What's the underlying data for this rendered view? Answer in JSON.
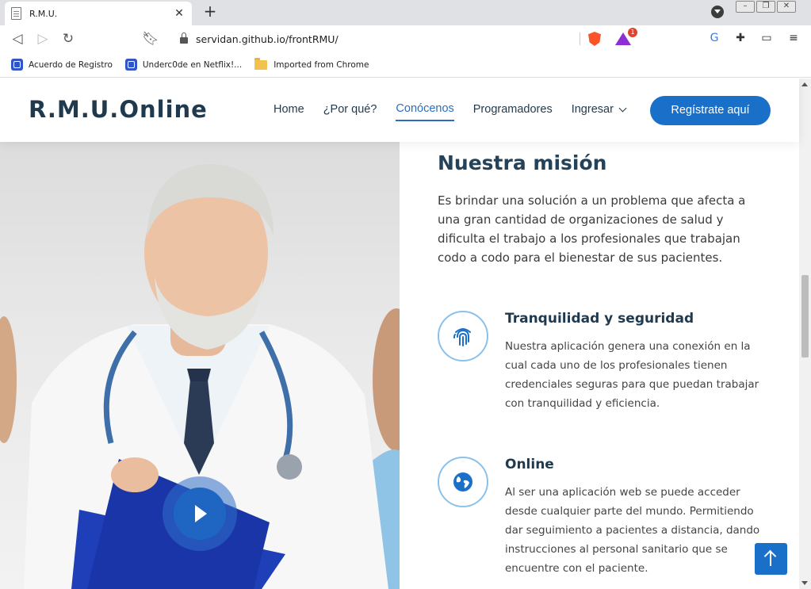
{
  "browser": {
    "tab": {
      "title": "R.M.U.",
      "favicon_icon": "document-icon",
      "close_icon": "close-icon"
    },
    "new_tab_icon": "plus-icon",
    "url": "servidan.github.io/frontRMU/",
    "bat_badge": "1",
    "bookmarks": [
      {
        "label": "Acuerdo de Registro",
        "icon": "site-favicon-icon"
      },
      {
        "label": "Underc0de en Netflix!...",
        "icon": "site-favicon-icon"
      },
      {
        "label": "Imported from Chrome",
        "icon": "folder-icon"
      }
    ]
  },
  "site": {
    "logo": "R.M.U.Online",
    "nav": {
      "home": "Home",
      "por_que": "¿Por qué?",
      "conocenos": "Conócenos",
      "programadores": "Programadores",
      "ingresar": "Ingresar"
    },
    "cta": "Regístrate aquí",
    "active_nav": "Conócenos",
    "accent_color": "#1a6fc9"
  },
  "mission": {
    "title": "Nuestra misión",
    "text": "Es brindar una solución a un problema que afecta a una gran cantidad de organizaciones de salud y dificulta el trabajo a los profesionales que trabajan codo a codo para el bienestar de sus pacientes."
  },
  "features": [
    {
      "icon": "fingerprint-icon",
      "title": "Tranquilidad y seguridad",
      "text": "Nuestra aplicación genera una conexión en la cual cada uno de los profesionales tienen credenciales seguras para que puedan trabajar con tranquilidad y eficiencia."
    },
    {
      "icon": "globe-icon",
      "title": "Online",
      "text": "Al ser una aplicación web se puede acceder desde cualquier parte del mundo. Permitiendo dar seguimiento a pacientes a distancia, dando instrucciones al personal sanitario que se encuentre con el paciente."
    }
  ]
}
